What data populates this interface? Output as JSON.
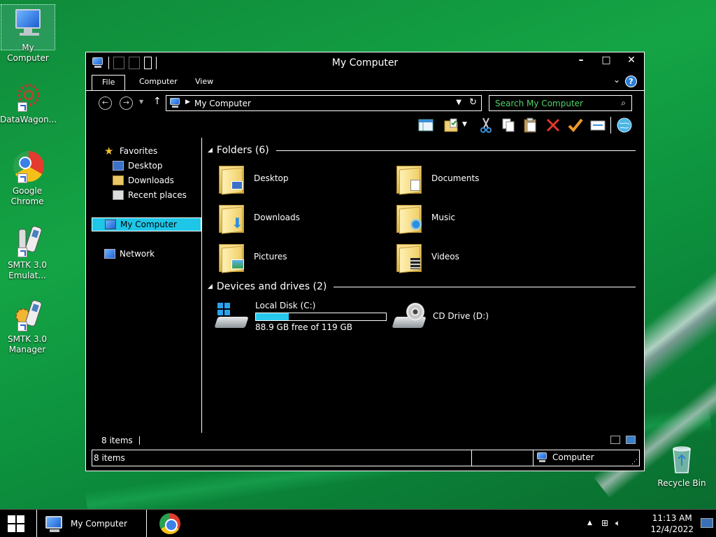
{
  "desktop": {
    "icons": [
      {
        "label": "My Computer"
      },
      {
        "label": "DataWagon..."
      },
      {
        "label": "Google Chrome"
      },
      {
        "label": "SMTK 3.0 Emulat..."
      },
      {
        "label": "SMTK 3.0 Manager"
      },
      {
        "label": "Recycle Bin"
      }
    ]
  },
  "window": {
    "title": "My Computer",
    "controls": {
      "minimize": "–",
      "maximize": "□",
      "close": "✕"
    },
    "ribbon_tabs": [
      {
        "label": "File",
        "active": true
      },
      {
        "label": "Computer"
      },
      {
        "label": "View"
      }
    ],
    "help": "?",
    "address": {
      "path": "My Computer"
    },
    "search": {
      "placeholder": "Search My Computer"
    },
    "navpane": {
      "favorites": "Favorites",
      "desktop": "Desktop",
      "downloads": "Downloads",
      "recent": "Recent places",
      "computer": "My Computer",
      "network": "Network"
    },
    "groups": {
      "folders": "Folders (6)",
      "devices": "Devices and drives (2)"
    },
    "folders": [
      {
        "label": "Desktop",
        "icon": "desktop-folder-icon"
      },
      {
        "label": "Documents",
        "icon": "documents-folder-icon"
      },
      {
        "label": "Downloads",
        "icon": "downloads-folder-icon"
      },
      {
        "label": "Music",
        "icon": "music-folder-icon"
      },
      {
        "label": "Pictures",
        "icon": "pictures-folder-icon"
      },
      {
        "label": "Videos",
        "icon": "videos-folder-icon"
      }
    ],
    "drives": [
      {
        "label": "Local Disk (C:)",
        "free_text": "88.9 GB free of 119 GB",
        "used_fraction": 0.253
      },
      {
        "label": "CD Drive (D:)"
      }
    ],
    "footer_count": "8 items",
    "status": {
      "count": "8 items",
      "location": "Computer"
    }
  },
  "taskbar": {
    "window_button": "My Computer",
    "time": "11:13 AM",
    "date": "12/4/2022"
  },
  "colors": {
    "selection": "#1ec6e8",
    "search_text": "#4fd26a",
    "accent": "#2b7fd9"
  }
}
